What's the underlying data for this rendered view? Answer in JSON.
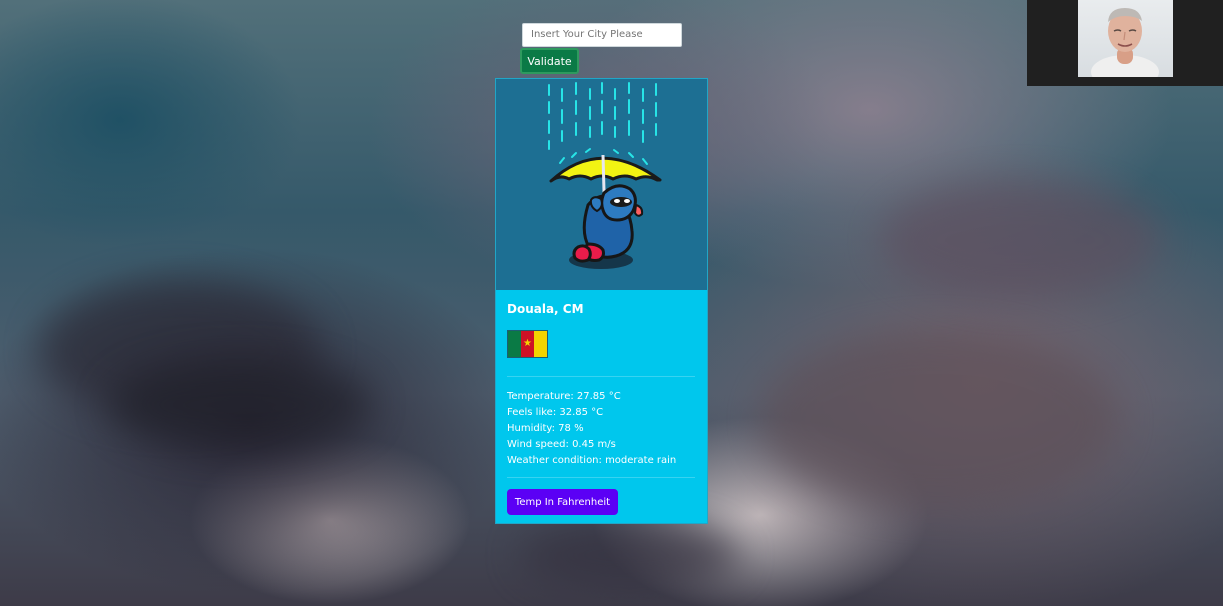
{
  "search": {
    "placeholder": "Insert Your City Please",
    "button_label": "Validate"
  },
  "weather": {
    "city": "Douala, CM",
    "country_flag": "Cameroon flag",
    "details": [
      "Temperature: 27.85 °C",
      "Feels like: 32.85 °C",
      "Humidity: 78 %",
      "Wind speed: 0.45 m/s",
      "Weather condition: moderate rain"
    ],
    "convert_button": "Temp In Fahrenheit"
  },
  "icons": {
    "illustration": "rain-umbrella-illustration",
    "flag": "cameroon-flag-icon",
    "camera": "webcam-feed"
  },
  "colors": {
    "validate_green": "#0a7a46",
    "card_cyan": "#00c7ed",
    "card_top": "#1d6f93",
    "convert_purple": "#5b00f5"
  }
}
